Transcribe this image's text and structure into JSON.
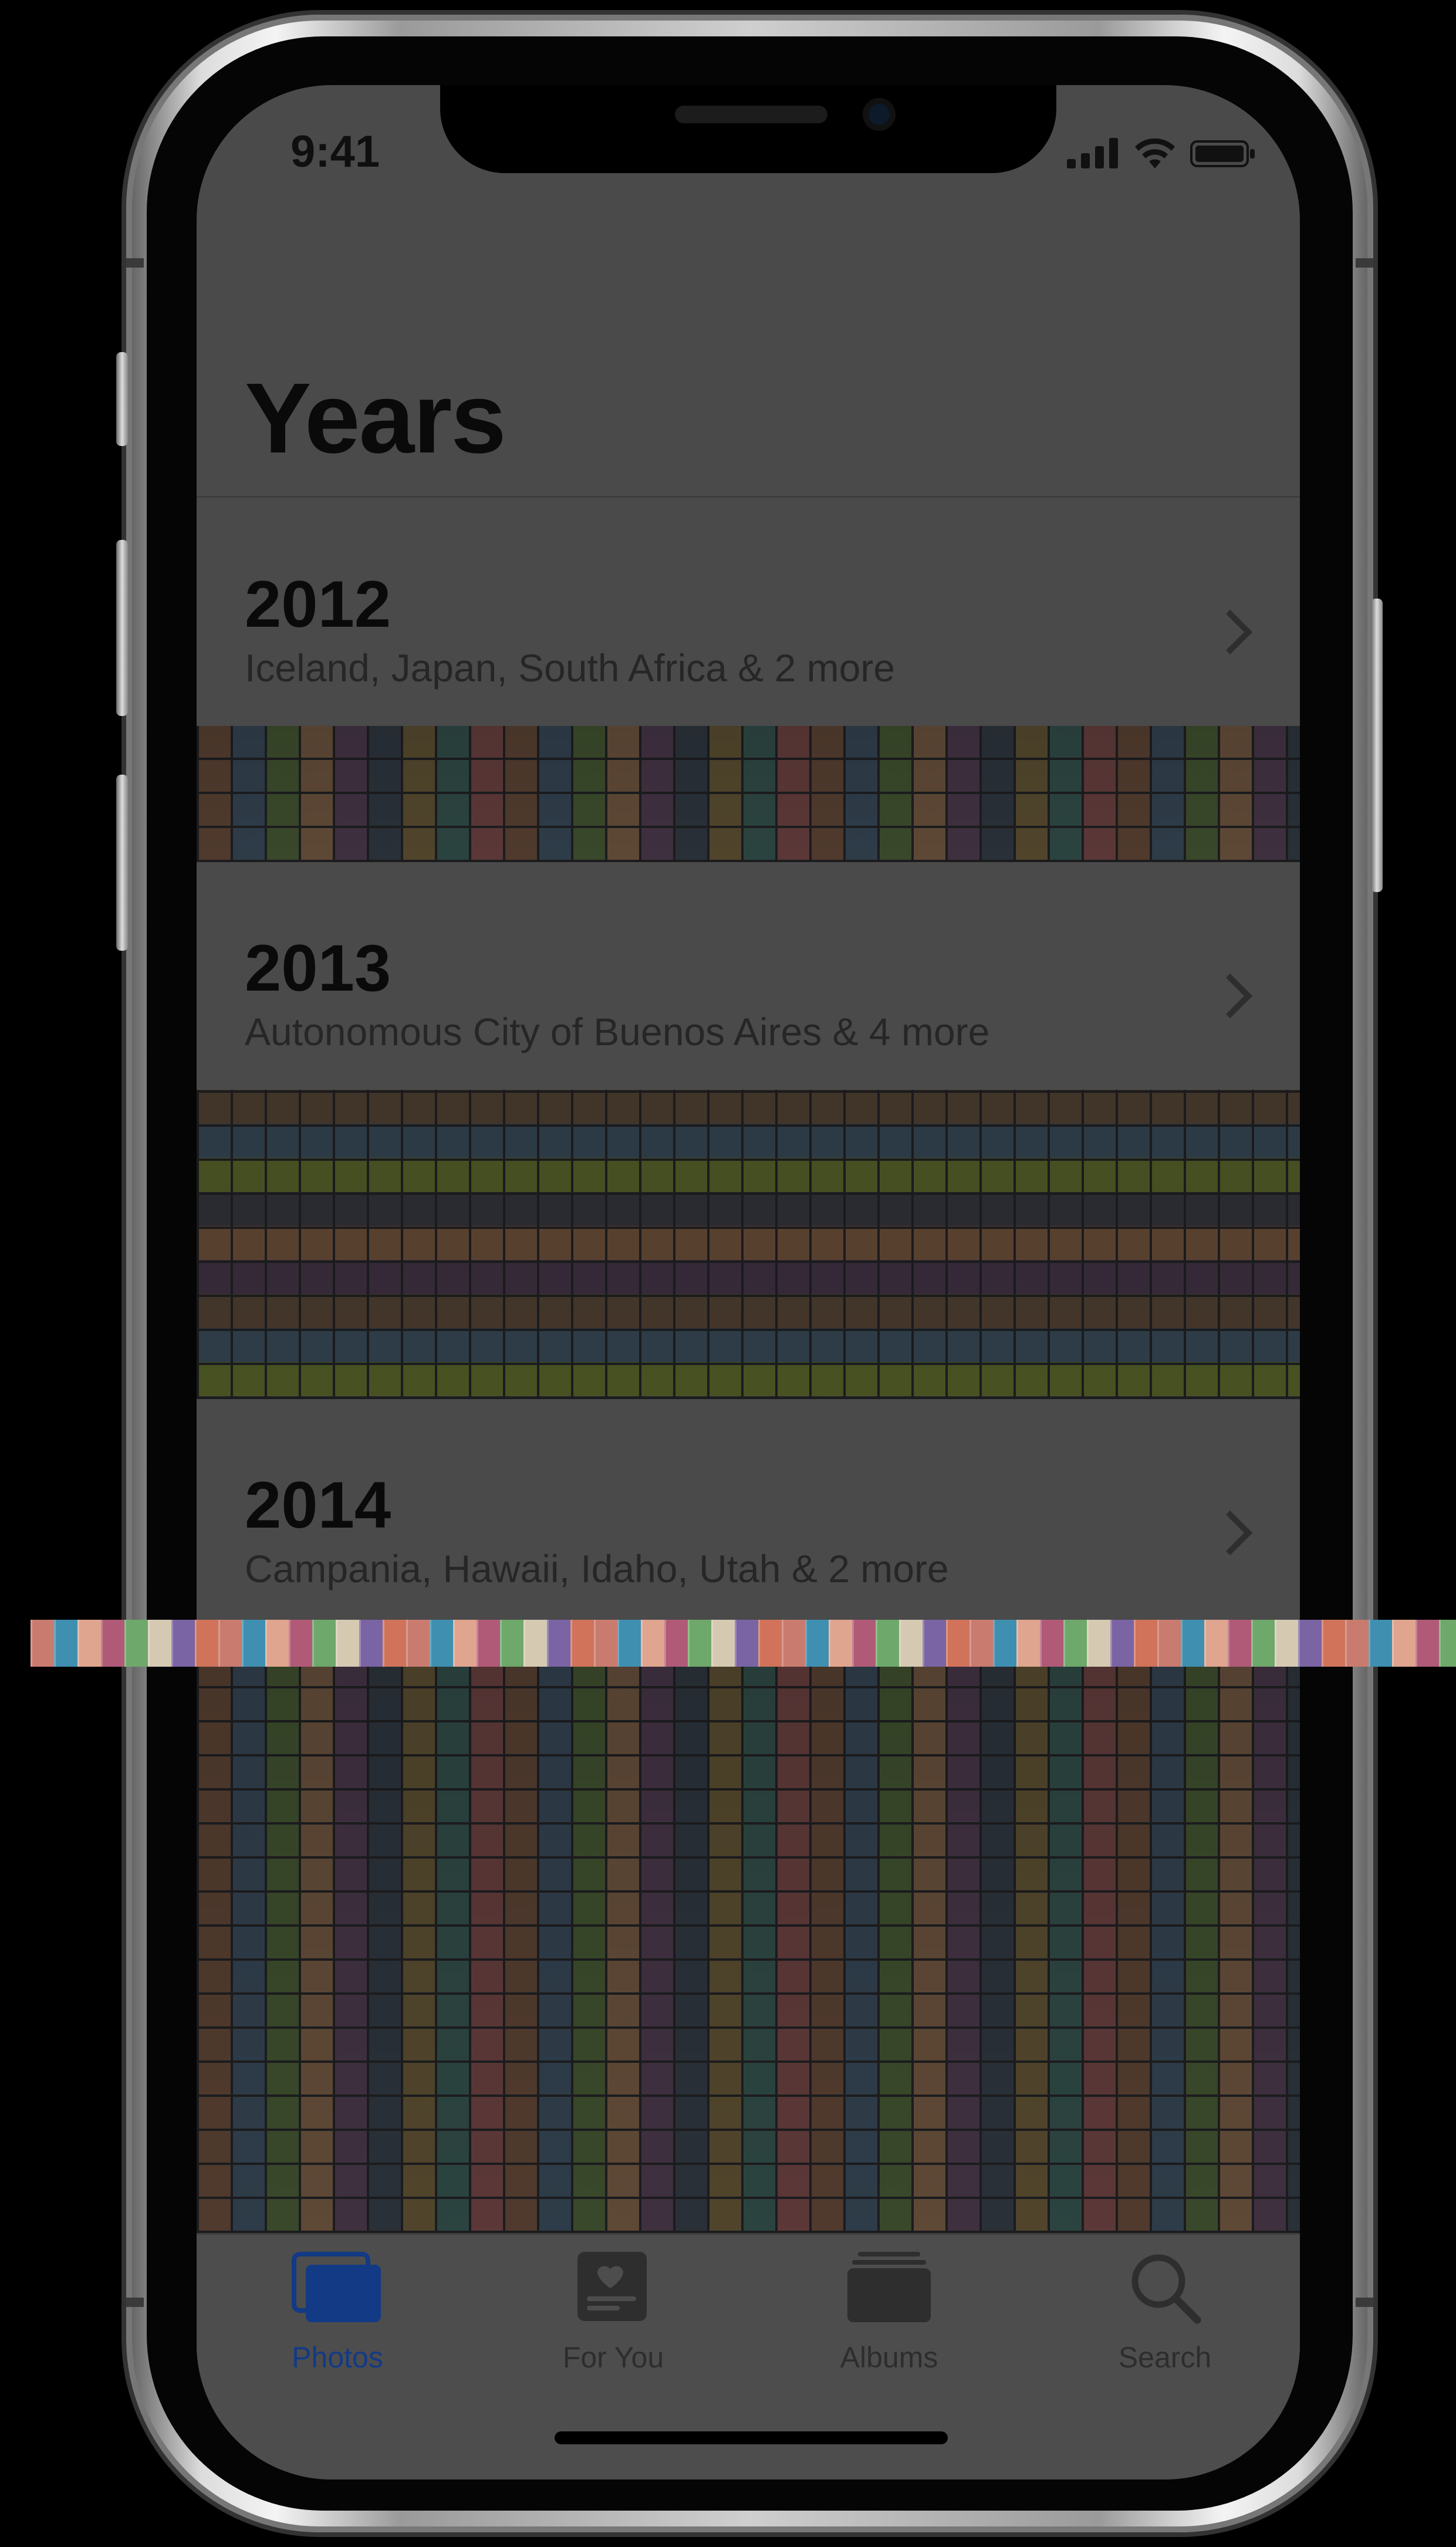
{
  "status_bar": {
    "time": "9:41"
  },
  "page": {
    "title": "Years"
  },
  "years": [
    {
      "year": "2012",
      "locations": "Iceland, Japan, South Africa & 2 more"
    },
    {
      "year": "2013",
      "locations": "Autonomous City of Buenos Aires & 4 more"
    },
    {
      "year": "2014",
      "locations": "Campania, Hawaii, Idaho, Utah & 2 more"
    }
  ],
  "tab_bar": {
    "tabs": [
      {
        "label": "Photos",
        "icon": "photos-icon",
        "active": true
      },
      {
        "label": "For You",
        "icon": "for-you-icon",
        "active": false
      },
      {
        "label": "Albums",
        "icon": "albums-icon",
        "active": false
      },
      {
        "label": "Search",
        "icon": "search-icon",
        "active": false
      }
    ]
  },
  "colors": {
    "active_tab": "#123a85",
    "screen_dimmed": "#4a4a4a"
  }
}
